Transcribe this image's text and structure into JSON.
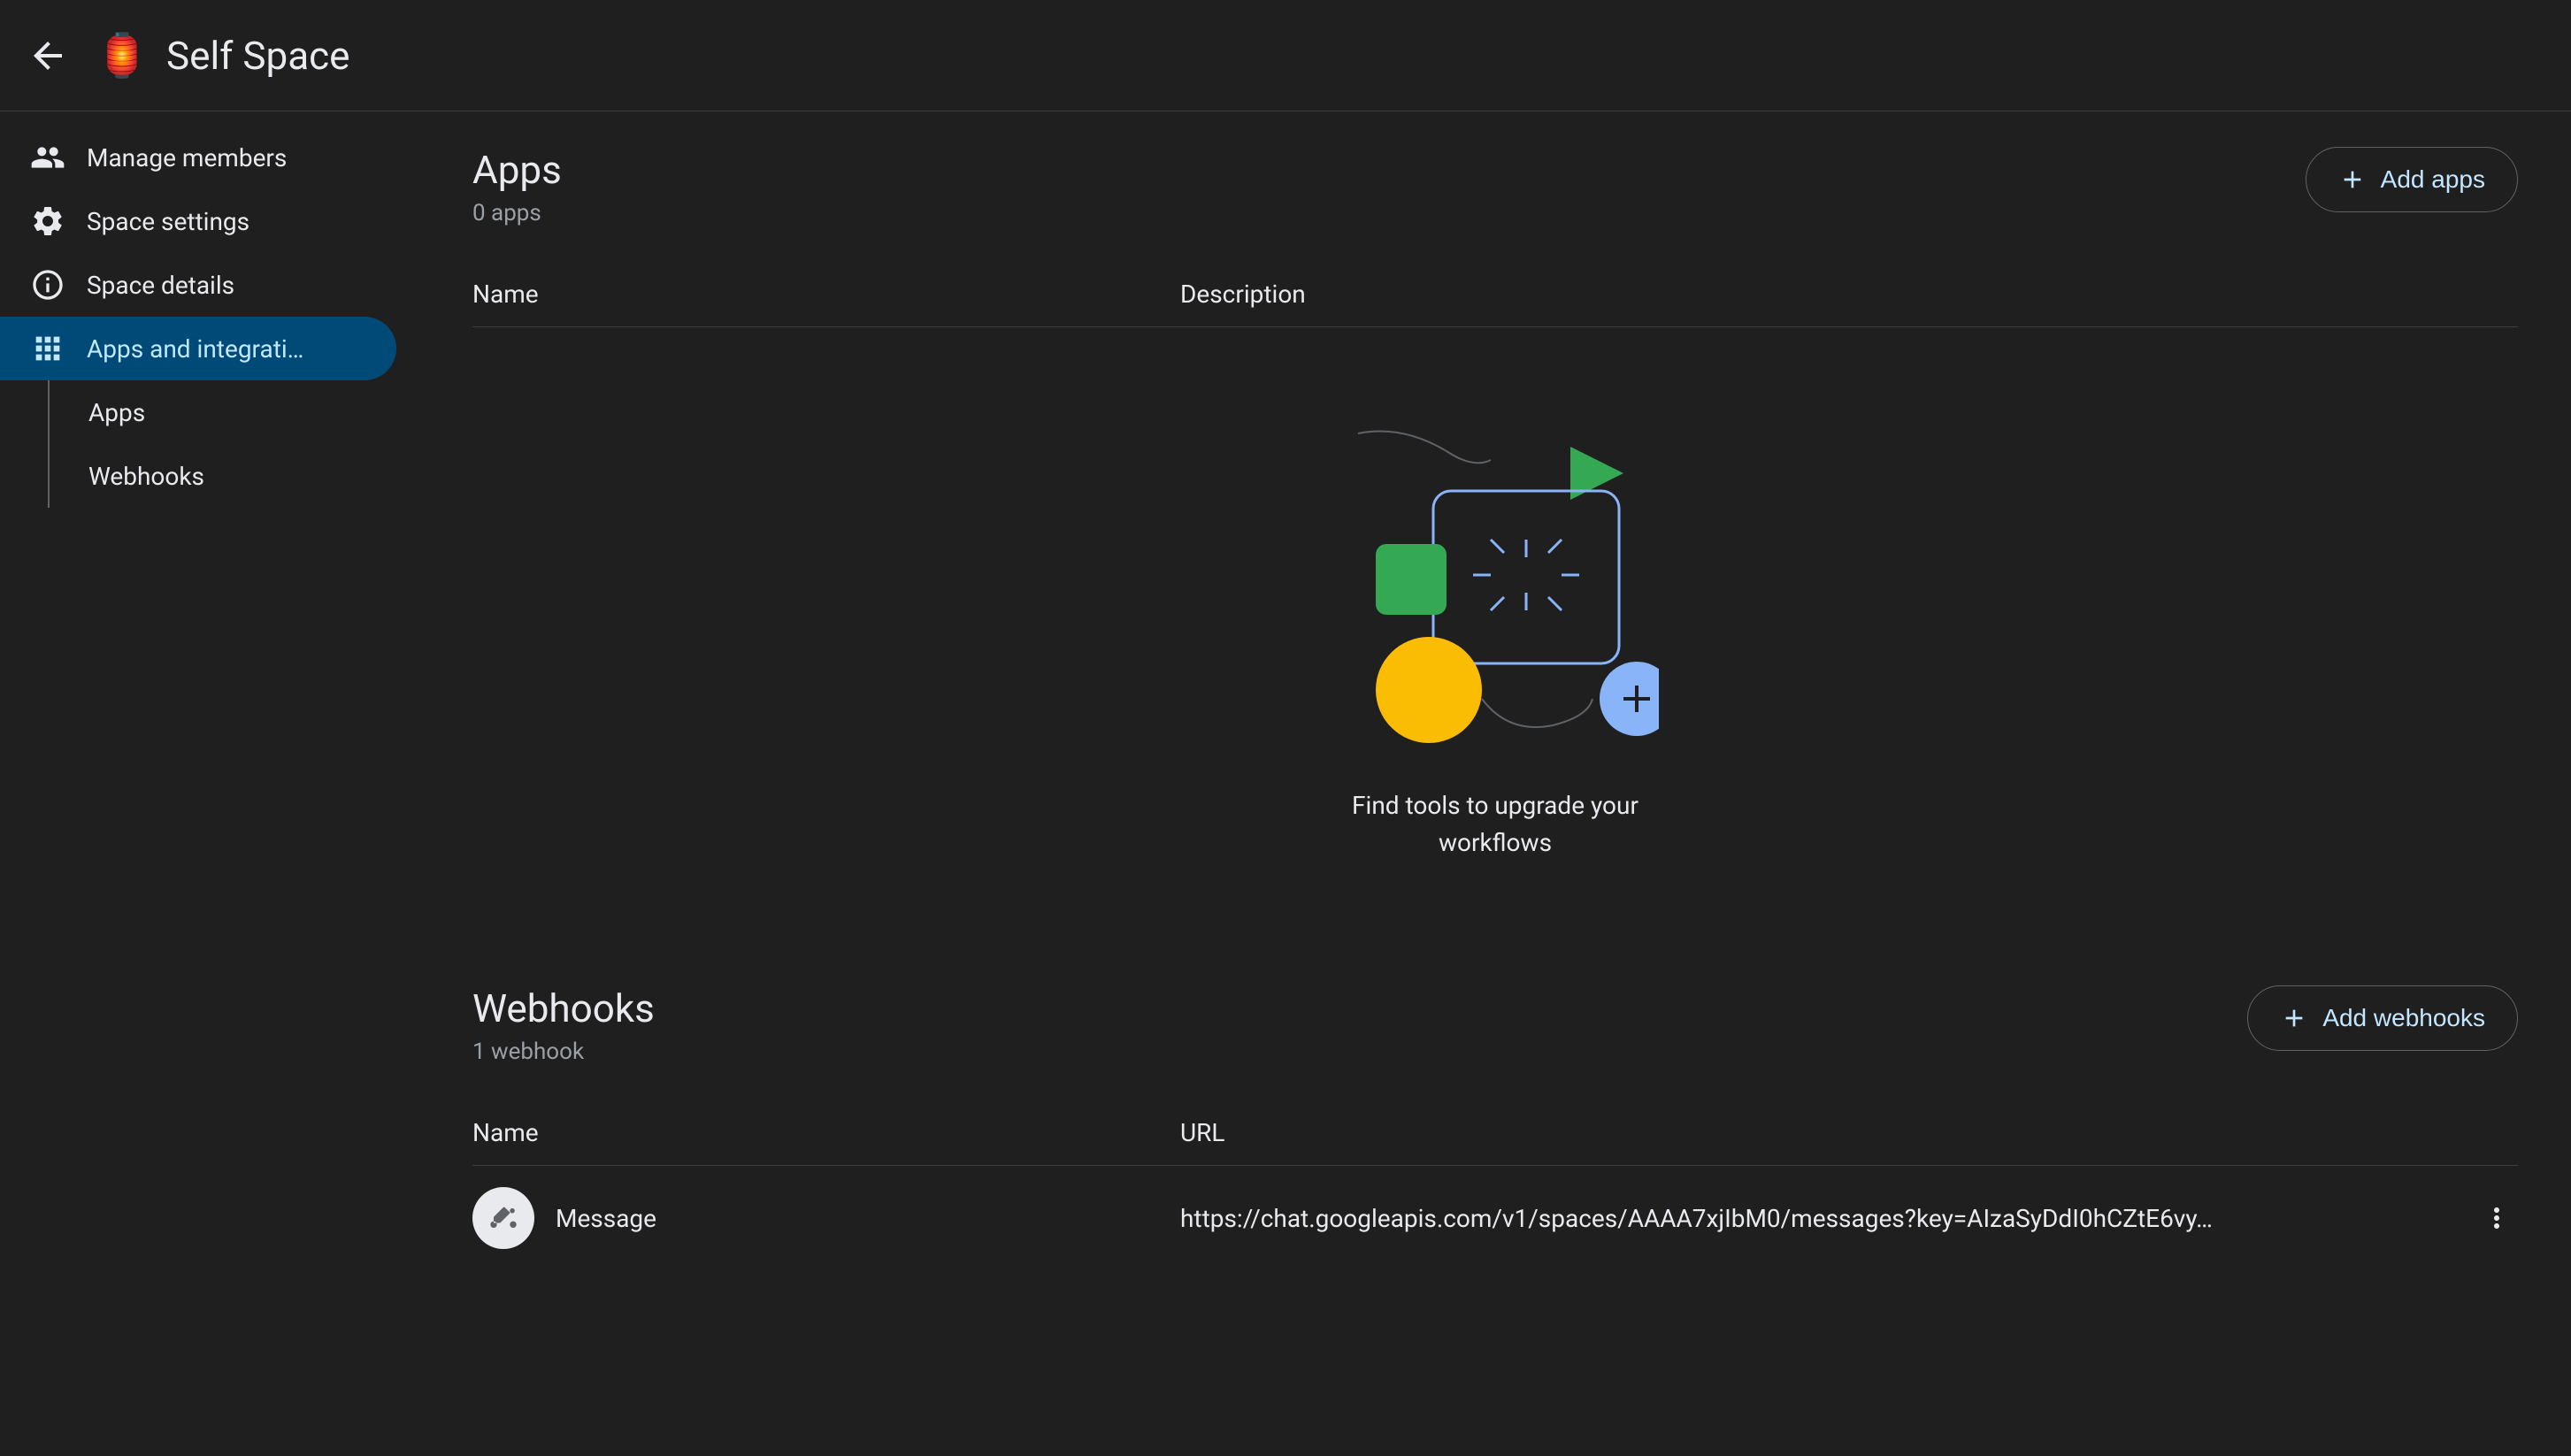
{
  "header": {
    "title": "Self Space",
    "icon": "🏮"
  },
  "sidebar": {
    "items": [
      {
        "label": "Manage members",
        "icon": "members"
      },
      {
        "label": "Space settings",
        "icon": "gear"
      },
      {
        "label": "Space details",
        "icon": "info"
      },
      {
        "label": "Apps and integrati…",
        "icon": "apps",
        "active": true
      }
    ],
    "subItems": [
      {
        "label": "Apps"
      },
      {
        "label": "Webhooks"
      }
    ]
  },
  "apps": {
    "title": "Apps",
    "count": "0 apps",
    "addButton": "Add apps",
    "columns": {
      "name": "Name",
      "description": "Description"
    },
    "emptyMessage": "Find tools to upgrade your workflows"
  },
  "webhooks": {
    "title": "Webhooks",
    "count": "1 webhook",
    "addButton": "Add webhooks",
    "columns": {
      "name": "Name",
      "url": "URL"
    },
    "rows": [
      {
        "name": "Message",
        "url": "https://chat.googleapis.com/v1/spaces/AAAA7xjIbM0/messages?key=AIzaSyDdI0hCZtE6vy…"
      }
    ]
  }
}
